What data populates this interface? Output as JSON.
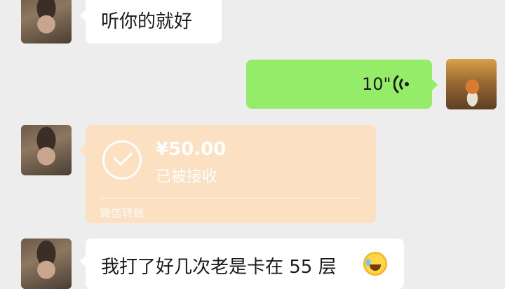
{
  "messages": [
    {
      "side": "left",
      "text": "听你的就好",
      "avatar": "baby-avatar"
    },
    {
      "side": "right",
      "voice": {
        "duration": "10\"",
        "icon": "voice-wave-icon"
      },
      "avatar": "fox-avatar"
    },
    {
      "side": "left",
      "transfer": {
        "amount": "¥50.00",
        "status": "已被接收",
        "footer": "微信转账",
        "icon": "check-circle-icon"
      },
      "avatar": "baby-avatar"
    },
    {
      "side": "left",
      "text": "我打了好几次老是卡在 55 层",
      "emoji": "crying-laughing-emoji",
      "avatar": "baby-avatar"
    }
  ],
  "colors": {
    "background": "#ededed",
    "bubble_white": "#ffffff",
    "bubble_green": "#95ec69",
    "transfer_bubble": "#fbe0c2"
  }
}
